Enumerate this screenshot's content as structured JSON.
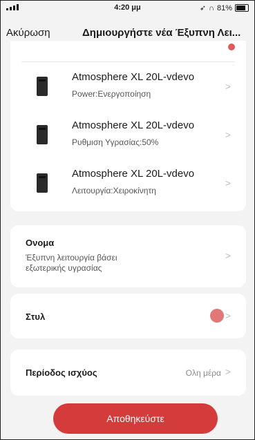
{
  "statusbar": {
    "time": "4:20 μμ",
    "battery": "81%"
  },
  "header": {
    "cancel_label": "Ακύρωση",
    "title": "Δημιουργήστε νέα Έξυπνη Λει..."
  },
  "devices": [
    {
      "name": "Atmosphere XL 20L-vdevo",
      "status": "Power:Ενεργοποίηση"
    },
    {
      "name": "Atmosphere XL 20L-vdevo",
      "status": "Ρυθμιση Υγρασίας:50%"
    },
    {
      "name": "Atmosphere XL 20L-vdevo",
      "status": "Λειτουργία:Χειροκίνητη"
    }
  ],
  "name_card": {
    "label": "Ονομα",
    "value_line1": "Έξυπνη λειτουργία βάσει",
    "value_line2": "εξωτερικής υγρασίας"
  },
  "style_card": {
    "label": "Στυλ",
    "color": "#e17777"
  },
  "period_card": {
    "label": "Περίοδος ισχύος",
    "value": "Ολη μέρα"
  },
  "save_button": {
    "label": "Αποθηκεύστε"
  },
  "colors": {
    "accent": "#d43b3b"
  }
}
